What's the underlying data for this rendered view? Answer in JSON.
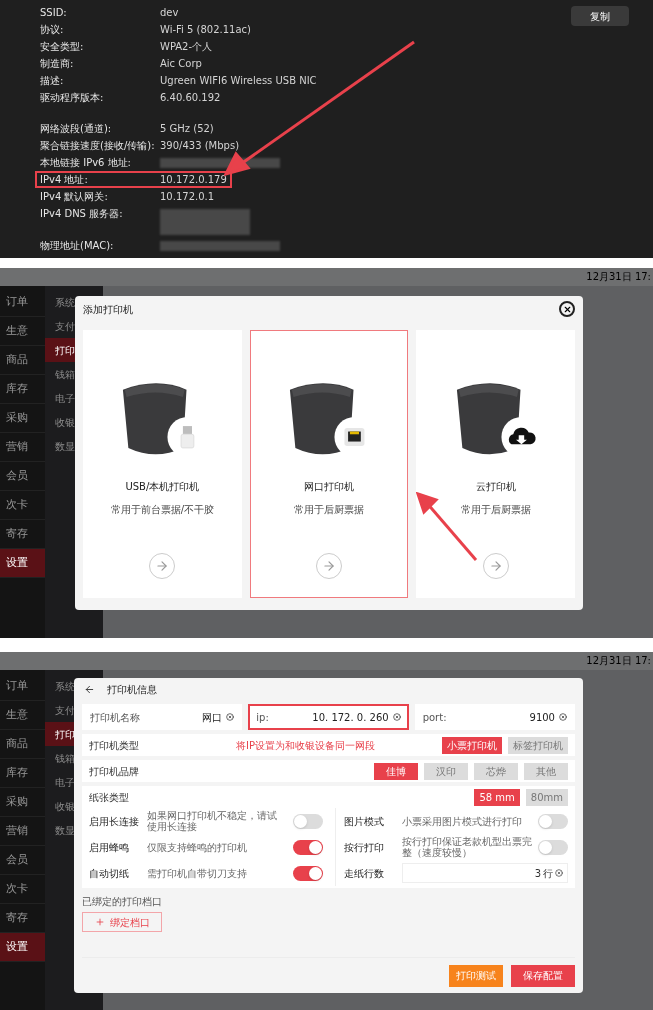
{
  "network_properties": {
    "copy_button": "复制",
    "groups": [
      [
        {
          "label": "SSID:",
          "value": "dev",
          "kind": "text",
          "highlighted": false
        },
        {
          "label": "协议:",
          "value": "Wi-Fi 5 (802.11ac)",
          "kind": "text",
          "highlighted": false
        },
        {
          "label": "安全类型:",
          "value": "WPA2-个人",
          "kind": "text",
          "highlighted": false
        },
        {
          "label": "制造商:",
          "value": "Aic Corp",
          "kind": "text",
          "highlighted": false
        },
        {
          "label": "描述:",
          "value": "Ugreen WIFI6 Wireless USB NIC",
          "kind": "text",
          "highlighted": false
        },
        {
          "label": "驱动程序版本:",
          "value": "6.40.60.192",
          "kind": "text",
          "highlighted": false
        }
      ],
      [
        {
          "label": "网络波段(通道):",
          "value": "5 GHz (52)",
          "kind": "text",
          "highlighted": false
        },
        {
          "label": "聚合链接速度(接收/传输):",
          "value": "390/433 (Mbps)",
          "kind": "text",
          "highlighted": false
        },
        {
          "label": "本地链接 IPv6 地址:",
          "kind": "blurred",
          "highlighted": false
        },
        {
          "label": "IPv4 地址:",
          "value": "10.172.0.179",
          "kind": "text",
          "highlighted": true
        },
        {
          "label": "IPv4 默认网关:",
          "value": "10.172.0.1",
          "kind": "text",
          "highlighted": false
        },
        {
          "label": "IPv4 DNS 服务器:",
          "kind": "blurred_tall",
          "highlighted": false
        },
        {
          "label": "物理地址(MAC):",
          "kind": "blurred",
          "highlighted": false
        }
      ]
    ]
  },
  "add_printer_screen": {
    "app": {
      "clock": "12月31日 17:",
      "main_menu": [
        {
          "label": "订单",
          "selected": false
        },
        {
          "label": "生意",
          "selected": false
        },
        {
          "label": "商品",
          "selected": false
        },
        {
          "label": "库存",
          "selected": false
        },
        {
          "label": "采购",
          "selected": false
        },
        {
          "label": "营销",
          "selected": false
        },
        {
          "label": "会员",
          "selected": false
        },
        {
          "label": "次卡",
          "selected": false
        },
        {
          "label": "寄存",
          "selected": false
        },
        {
          "label": "设置",
          "selected": true
        }
      ],
      "sub_menu": [
        {
          "label": "系统",
          "selected": false
        },
        {
          "label": "支付",
          "selected": false
        },
        {
          "label": "打印",
          "selected": true
        },
        {
          "label": "钱箱",
          "selected": false
        },
        {
          "label": "电子",
          "selected": false
        },
        {
          "label": "收银",
          "selected": false
        },
        {
          "label": "数显",
          "selected": false
        }
      ]
    },
    "dialog": {
      "title": "添加打印机",
      "options": [
        {
          "kind": "usb",
          "title": "USB/本机打印机",
          "subtitle": "常用于前台票据/不干胶",
          "selected": false
        },
        {
          "kind": "network",
          "title": "网口打印机",
          "subtitle": "常用于后厨票据",
          "selected": true
        },
        {
          "kind": "cloud",
          "title": "云打印机",
          "subtitle": "常用于后厨票据",
          "selected": false
        }
      ]
    }
  },
  "printer_info_screen": {
    "app": {
      "clock": "12月31日 17:",
      "main_menu": [
        {
          "label": "订单",
          "selected": false
        },
        {
          "label": "生意",
          "selected": false
        },
        {
          "label": "商品",
          "selected": false
        },
        {
          "label": "库存",
          "selected": false
        },
        {
          "label": "采购",
          "selected": false
        },
        {
          "label": "营销",
          "selected": false
        },
        {
          "label": "会员",
          "selected": false
        },
        {
          "label": "次卡",
          "selected": false
        },
        {
          "label": "寄存",
          "selected": false
        },
        {
          "label": "设置",
          "selected": true
        }
      ],
      "sub_menu": [
        {
          "label": "系统",
          "selected": false
        },
        {
          "label": "支付",
          "selected": false
        },
        {
          "label": "打印",
          "selected": true
        },
        {
          "label": "钱箱",
          "selected": false
        },
        {
          "label": "电子",
          "selected": false
        },
        {
          "label": "收银",
          "selected": false
        },
        {
          "label": "数显",
          "selected": false
        }
      ]
    },
    "dialog": {
      "title": "打印机信息",
      "fields": [
        {
          "label": "打印机名称",
          "value": "网口",
          "highlighted": false
        },
        {
          "label": "ip:",
          "value": "10. 172. 0. 260",
          "highlighted": true
        },
        {
          "label": "port:",
          "value": "9100",
          "highlighted": false
        }
      ],
      "note": "将IP设置为和收银设备同一网段",
      "option_rows": [
        {
          "label": "打印机类型",
          "options": [
            {
              "label": "小票打印机",
              "selected": true
            },
            {
              "label": "标签打印机",
              "selected": false
            }
          ]
        },
        {
          "label": "打印机品牌",
          "options": [
            {
              "label": "佳博",
              "selected": true
            },
            {
              "label": "汉印",
              "selected": false
            },
            {
              "label": "芯烨",
              "selected": false
            },
            {
              "label": "其他",
              "selected": false
            }
          ]
        },
        {
          "label": "纸张类型",
          "options": [
            {
              "label": "58 mm",
              "selected": true
            },
            {
              "label": "80mm",
              "selected": false
            }
          ]
        }
      ],
      "settings_left": [
        {
          "kind": "toggle",
          "label": "启用长连接",
          "hint": "如果网口打印机不稳定，请试使用长连接",
          "on": false
        },
        {
          "kind": "toggle",
          "label": "启用蜂鸣",
          "hint": "仅限支持蜂鸣的打印机",
          "on": true
        },
        {
          "kind": "toggle",
          "label": "自动切纸",
          "hint": "需打印机自带切刀支持",
          "on": true
        }
      ],
      "settings_right": [
        {
          "kind": "toggle",
          "label": "图片模式",
          "hint": "小票采用图片模式进行打印",
          "on": false
        },
        {
          "kind": "toggle",
          "label": "按行打印",
          "hint": "按行打印保证老款机型出票完整（速度较慢）",
          "on": false
        },
        {
          "kind": "input",
          "label": "走纸行数",
          "value": "3",
          "unit": "行"
        }
      ],
      "bound_ports_label": "已绑定的打印档口",
      "bind_button": "绑定档口",
      "buttons": [
        {
          "label": "打印测试",
          "kind": "secondary"
        },
        {
          "label": "保存配置",
          "kind": "primary"
        }
      ]
    }
  }
}
